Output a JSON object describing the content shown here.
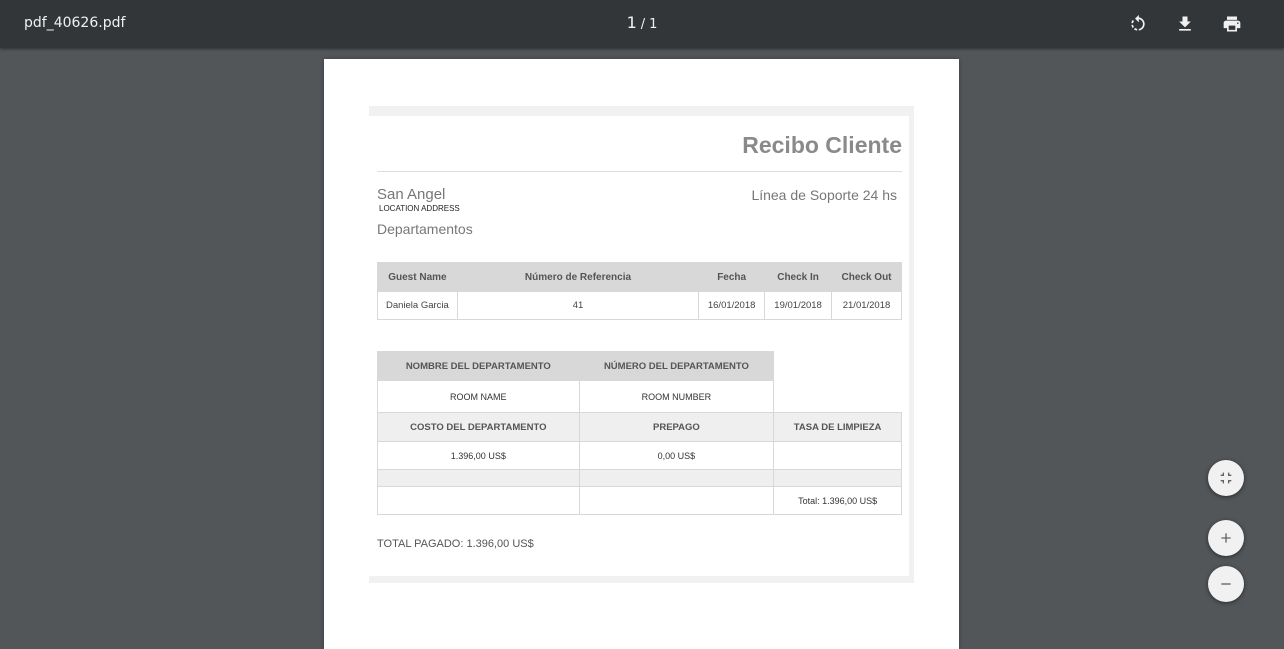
{
  "viewer": {
    "file_name": "pdf_40626.pdf",
    "current_page": "1",
    "separator": "/",
    "total_pages": "1",
    "icons": {
      "rotate": "rotate-icon",
      "download": "download-icon",
      "print": "print-icon",
      "fit": "fit-to-page-icon",
      "zoom_in": "zoom-in-icon",
      "zoom_out": "zoom-out-icon"
    }
  },
  "receipt": {
    "title": "Recibo Cliente",
    "company": "San Angel",
    "address": "LOCATION ADDRESS",
    "department": "Departamentos",
    "support": "Línea de Soporte 24 hs",
    "guest_table": {
      "headers": [
        "Guest Name",
        "Número de Referencia",
        "Fecha",
        "Check In",
        "Check Out"
      ],
      "row": [
        "Daniela Garcia",
        "41",
        "16/01/2018",
        "19/01/2018",
        "21/01/2018"
      ]
    },
    "room_table": {
      "header1": [
        "NOMBRE DEL DEPARTAMENTO",
        "NÚMERO DEL DEPARTAMENTO"
      ],
      "values1": [
        "ROOM NAME",
        "ROOM NUMBER"
      ],
      "header2": [
        "COSTO DEL DEPARTAMENTO",
        "PREPAGO",
        "TASA DE LIMPIEZA"
      ],
      "values2": [
        "1.396,00 US$",
        "0,00 US$",
        ""
      ],
      "total": "Total: 1.396,00 US$"
    },
    "total_paid": "TOTAL PAGADO: 1.396,00 US$"
  }
}
